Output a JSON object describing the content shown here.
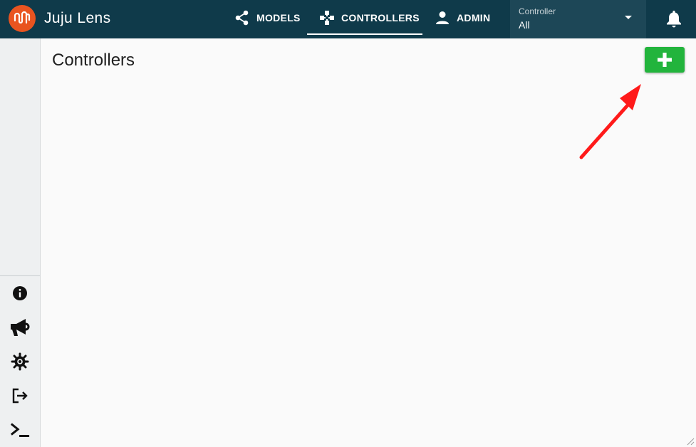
{
  "app": {
    "title": "Juju Lens"
  },
  "nav": {
    "tabs": [
      {
        "label": "MODELS",
        "icon": "share-icon"
      },
      {
        "label": "CONTROLLERS",
        "icon": "gamepad-icon",
        "active": true
      },
      {
        "label": "ADMIN",
        "icon": "person-icon"
      }
    ]
  },
  "controller_select": {
    "label": "Controller",
    "value": "All"
  },
  "page": {
    "title": "Controllers"
  },
  "sidebar": {
    "icons": [
      "info-icon",
      "megaphone-icon",
      "bug-icon",
      "logout-icon",
      "terminal-icon"
    ]
  },
  "colors": {
    "topbar": "#0f3a4a",
    "select_bg": "#1d4757",
    "logo": "#e95420",
    "add_button": "#22b43c",
    "annotation_arrow": "#ff1a1a"
  }
}
